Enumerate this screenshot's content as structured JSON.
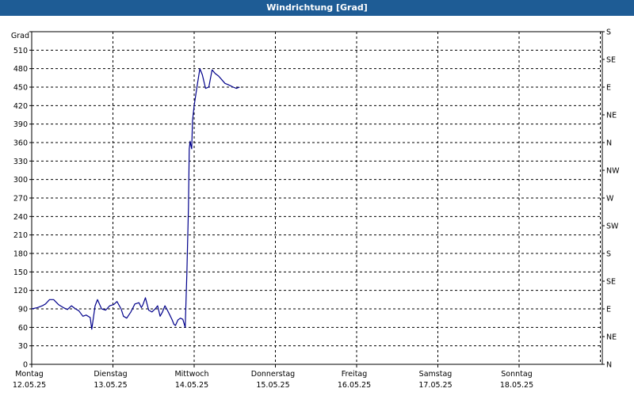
{
  "window": {
    "title": "Windrichtung [Grad]"
  },
  "chart_data": {
    "type": "line",
    "title": "Windrichtung [Grad]",
    "ylabel": "Grad",
    "ylim": [
      0,
      540
    ],
    "yticks": [
      0,
      30,
      60,
      90,
      120,
      150,
      180,
      210,
      240,
      270,
      300,
      330,
      360,
      390,
      420,
      450,
      480,
      510
    ],
    "right_axis_labels": [
      "N",
      "NE",
      "E",
      "SE",
      "S",
      "SW",
      "W",
      "NW",
      "N",
      "NE",
      "E",
      "SE",
      "S"
    ],
    "right_axis_values": [
      0,
      45,
      90,
      135,
      180,
      225,
      270,
      315,
      360,
      405,
      450,
      495,
      540
    ],
    "xlim": [
      0,
      7
    ],
    "x_days": [
      {
        "day": "Montag",
        "date": "12.05.25"
      },
      {
        "day": "Dienstag",
        "date": "13.05.25"
      },
      {
        "day": "Mittwoch",
        "date": "14.05.25"
      },
      {
        "day": "Donnerstag",
        "date": "15.05.25"
      },
      {
        "day": "Freitag",
        "date": "16.05.25"
      },
      {
        "day": "Samstag",
        "date": "17.05.25"
      },
      {
        "day": "Sonntag",
        "date": "18.05.25"
      }
    ],
    "grid": true,
    "color": "#00008b",
    "series": [
      {
        "x": [
          0,
          0.07,
          0.13,
          0.17,
          0.22,
          0.27,
          0.33,
          0.39,
          0.44,
          0.49,
          0.54,
          0.58,
          0.63,
          0.67,
          0.72,
          0.74,
          0.78,
          0.81,
          0.86,
          0.91,
          0.96,
          1.01,
          1.05,
          1.1,
          1.13,
          1.17,
          1.22,
          1.27,
          1.32,
          1.35,
          1.37,
          1.4,
          1.44,
          1.48,
          1.52,
          1.55,
          1.58,
          1.61,
          1.64,
          1.67,
          1.7,
          1.73,
          1.75,
          1.77,
          1.8,
          1.83,
          1.86,
          1.89,
          1.91,
          1.93,
          1.94,
          1.95,
          1.96,
          1.97,
          1.98,
          2.0,
          2.02,
          2.04,
          2.07,
          2.1,
          2.14,
          2.18,
          2.22,
          2.26,
          2.3,
          2.34,
          2.38,
          2.42,
          2.45,
          2.48,
          2.52,
          2.56
        ],
        "y": [
          90,
          92,
          95,
          98,
          105,
          105,
          97,
          92,
          89,
          95,
          90,
          87,
          78,
          80,
          76,
          57,
          95,
          105,
          90,
          88,
          95,
          97,
          102,
          90,
          78,
          75,
          85,
          98,
          100,
          92,
          97,
          108,
          88,
          85,
          90,
          95,
          78,
          85,
          95,
          88,
          80,
          72,
          65,
          63,
          72,
          75,
          73,
          60,
          148,
          255,
          350,
          362,
          355,
          350,
          395,
          420,
          438,
          455,
          480,
          470,
          448,
          450,
          478,
          472,
          468,
          462,
          456,
          454,
          452,
          450,
          448,
          450
        ]
      }
    ]
  }
}
